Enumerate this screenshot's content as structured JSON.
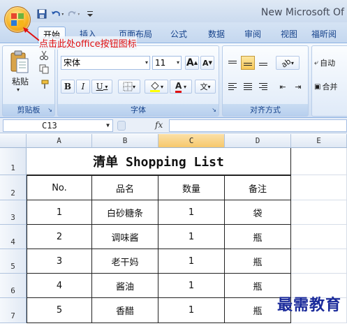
{
  "window": {
    "title": "New Microsoft Of"
  },
  "qat": {
    "save_icon": "save-icon",
    "undo_icon": "undo-icon",
    "redo_icon": "redo-icon"
  },
  "tabs": [
    {
      "label": "开始",
      "active": true
    },
    {
      "label": "插入"
    },
    {
      "label": "页面布局"
    },
    {
      "label": "公式"
    },
    {
      "label": "数据"
    },
    {
      "label": "审阅"
    },
    {
      "label": "视图"
    },
    {
      "label": "福昕阅"
    }
  ],
  "annotation": "点击此处office按钮图标",
  "ribbon": {
    "clipboard": {
      "label": "剪贴板",
      "paste": "粘贴"
    },
    "font": {
      "label": "字体",
      "name": "宋体",
      "size": "11",
      "grow": "A",
      "shrink": "A",
      "bold": "B",
      "italic": "I",
      "underline": "U",
      "fontcolor": "A",
      "phonetic": "文"
    },
    "alignment": {
      "label": "对齐方式"
    },
    "right_group": {
      "autowrap": "自动",
      "merge": "合并"
    }
  },
  "formula_bar": {
    "name_box": "C13",
    "fx": "fx",
    "formula": ""
  },
  "sheet": {
    "columns": [
      "A",
      "B",
      "C",
      "D",
      "E"
    ],
    "selected_column": "C",
    "rows": [
      "1",
      "2",
      "3",
      "4",
      "5",
      "6",
      "7"
    ],
    "title": "清单 Shopping List",
    "headers": [
      "No.",
      "品名",
      "数量",
      "备注"
    ],
    "data": [
      [
        "1",
        "白砂糖条",
        "1",
        "袋"
      ],
      [
        "2",
        "调味酱",
        "1",
        "瓶"
      ],
      [
        "3",
        "老干妈",
        "1",
        "瓶"
      ],
      [
        "4",
        "酱油",
        "1",
        "瓶"
      ],
      [
        "5",
        "香醋",
        "1",
        "瓶"
      ]
    ]
  },
  "watermark": "最需教育",
  "colors": {
    "accent": "#15428b",
    "annotation": "#e01010",
    "selected_header": "#f6c86b"
  }
}
